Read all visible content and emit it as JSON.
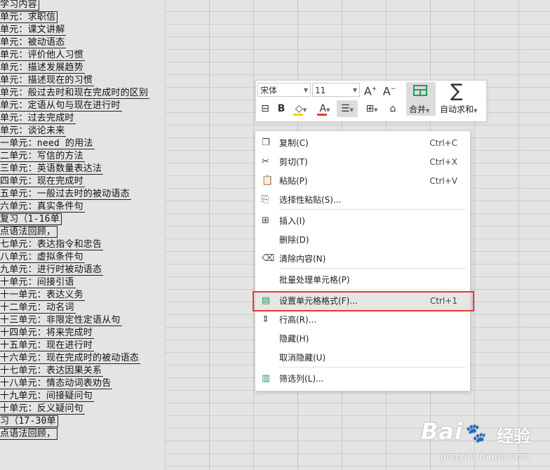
{
  "sheet": {
    "rows": [
      {
        "text": "学习内容",
        "boxed": true
      },
      {
        "text": "单元：求职信",
        "boxed": true
      },
      {
        "text": "单元：课文讲解"
      },
      {
        "text": "单元：被动语态"
      },
      {
        "text": "单元：评价他人习惯"
      },
      {
        "text": "单元：描述发展趋势"
      },
      {
        "text": "单元：描述现在的习惯"
      },
      {
        "text": "单元：般过去时和现在完成时的区别"
      },
      {
        "text": "单元：定语从句与现在进行时"
      },
      {
        "text": "单元：过去完成时"
      },
      {
        "text": "单元：谈论未来"
      },
      {
        "text": "一单元：need 的用法"
      },
      {
        "text": "二单元：写信的方法"
      },
      {
        "text": "三单元：英语数量表达法"
      },
      {
        "text": "四单元：现在完成时"
      },
      {
        "text": "五单元：一般过去时的被动语态"
      },
      {
        "text": "六单元：真实条件句"
      },
      {
        "text": "复习（1-16单",
        "boxed": true
      },
      {
        "text": "点语法回顾，",
        "boxed": true
      },
      {
        "text": "七单元：表达指令和忠告"
      },
      {
        "text": "八单元：虚拟条件句"
      },
      {
        "text": "九单元：进行时被动语态"
      },
      {
        "text": "十单元：间接引语"
      },
      {
        "text": "十一单元：表达义务"
      },
      {
        "text": "十二单元：动名词"
      },
      {
        "text": "十三单元：非限定性定语从句"
      },
      {
        "text": "十四单元：将来完成时"
      },
      {
        "text": "十五单元：现在进行时"
      },
      {
        "text": "十六单元：现在完成时的被动语态"
      },
      {
        "text": "十七单元：表达因果关系"
      },
      {
        "text": "十八单元：情态动词表劝告"
      },
      {
        "text": "十九单元：间接疑问句"
      },
      {
        "text": "十单元：反义疑问句"
      },
      {
        "text": "习（17-30单",
        "boxed": true
      },
      {
        "text": "点语法回顾，",
        "boxed": true
      }
    ]
  },
  "mini_toolbar": {
    "font_name": "宋体",
    "font_size": "11",
    "grow_font": "A⁺",
    "shrink_font": "A⁻",
    "merge_label": "合并",
    "autosum_label": "自动求和",
    "bold": "B",
    "font_color_letter": "A"
  },
  "context_menu": {
    "items": [
      {
        "label": "复制(C)",
        "shortcut": "Ctrl+C",
        "icon": "copy-icon"
      },
      {
        "label": "剪切(T)",
        "shortcut": "Ctrl+X",
        "icon": "scissors-icon"
      },
      {
        "label": "粘贴(P)",
        "shortcut": "Ctrl+V",
        "icon": "paste-icon"
      },
      {
        "label": "选择性粘贴(S)...",
        "shortcut": "",
        "icon": "paste-special-icon"
      },
      {
        "label": "插入(I)",
        "shortcut": "",
        "icon": "insert-icon"
      },
      {
        "label": "删除(D)",
        "shortcut": "",
        "icon": ""
      },
      {
        "label": "清除内容(N)",
        "shortcut": "",
        "icon": "eraser-icon"
      },
      {
        "label": "批量处理单元格(P)",
        "shortcut": "",
        "icon": ""
      },
      {
        "label": "设置单元格格式(F)...",
        "shortcut": "Ctrl+1",
        "icon": "format-cells-icon",
        "highlighted": true
      },
      {
        "label": "行高(R)...",
        "shortcut": "",
        "icon": "row-height-icon"
      },
      {
        "label": "隐藏(H)",
        "shortcut": "",
        "icon": ""
      },
      {
        "label": "取消隐藏(U)",
        "shortcut": "",
        "icon": ""
      },
      {
        "label": "筛选列(L)...",
        "shortcut": "",
        "icon": "filter-columns-icon"
      }
    ]
  },
  "watermark": {
    "logo": "Bai 经验",
    "jy": "经验",
    "url": "jingyan.baidu.com"
  },
  "colors": {
    "highlight_border": "#e53935",
    "merge_green": "#1e9e5a",
    "sheet_bg": "#e4e4e4"
  }
}
